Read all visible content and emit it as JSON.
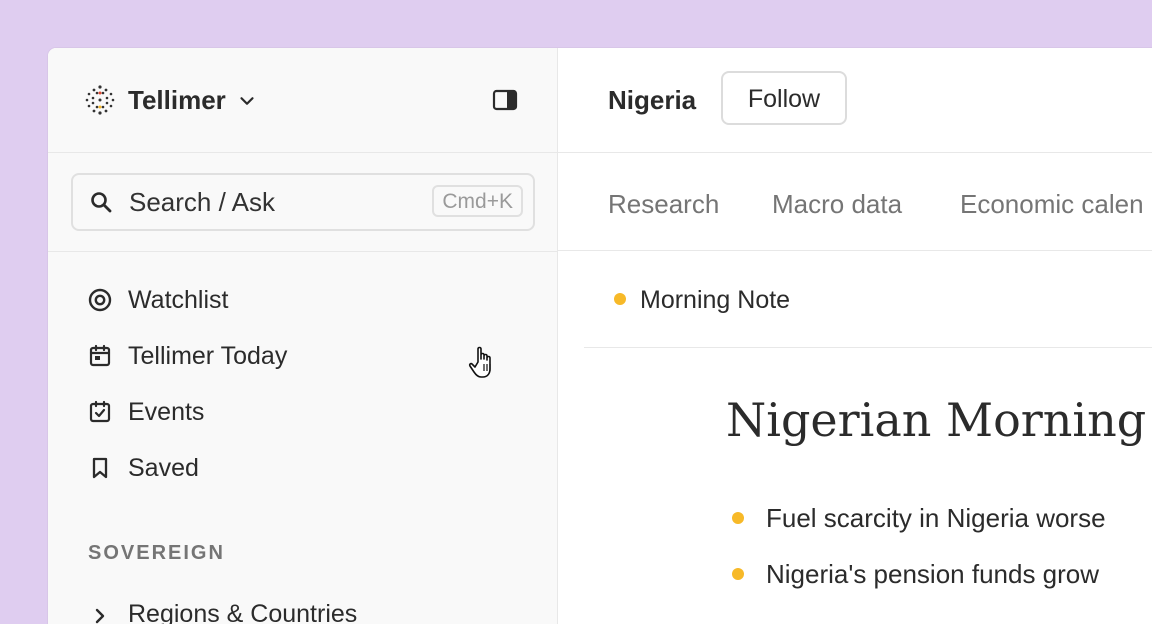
{
  "colors": {
    "accent": "#f7b928",
    "background": "#dfcdf0"
  },
  "sidebar": {
    "brand": {
      "name": "Tellimer",
      "logo_icon": "tellimer-logo-icon",
      "chevron_icon": "chevron-down-icon"
    },
    "panel_toggle_icon": "sidebar-panel-icon",
    "search": {
      "label": "Search / Ask",
      "shortcut": "Cmd+K",
      "icon": "search-icon"
    },
    "nav": [
      {
        "label": "Watchlist",
        "icon": "target-icon"
      },
      {
        "label": "Tellimer Today",
        "icon": "calendar-icon"
      },
      {
        "label": "Events",
        "icon": "calendar-check-icon"
      },
      {
        "label": "Saved",
        "icon": "bookmark-icon"
      }
    ],
    "section_label": "SOVEREIGN",
    "tree": [
      {
        "label": "Regions & Countries",
        "icon": "chevron-right-icon"
      }
    ]
  },
  "main": {
    "title": "Nigeria",
    "follow_label": "Follow",
    "tabs": [
      {
        "label": "Research"
      },
      {
        "label": "Macro data"
      },
      {
        "label": "Economic calen"
      }
    ],
    "note_label": "Morning Note",
    "article": {
      "title": "Nigerian Morning N",
      "bullets": [
        "Fuel scarcity in Nigeria worse",
        "Nigeria's pension funds grow"
      ]
    }
  }
}
